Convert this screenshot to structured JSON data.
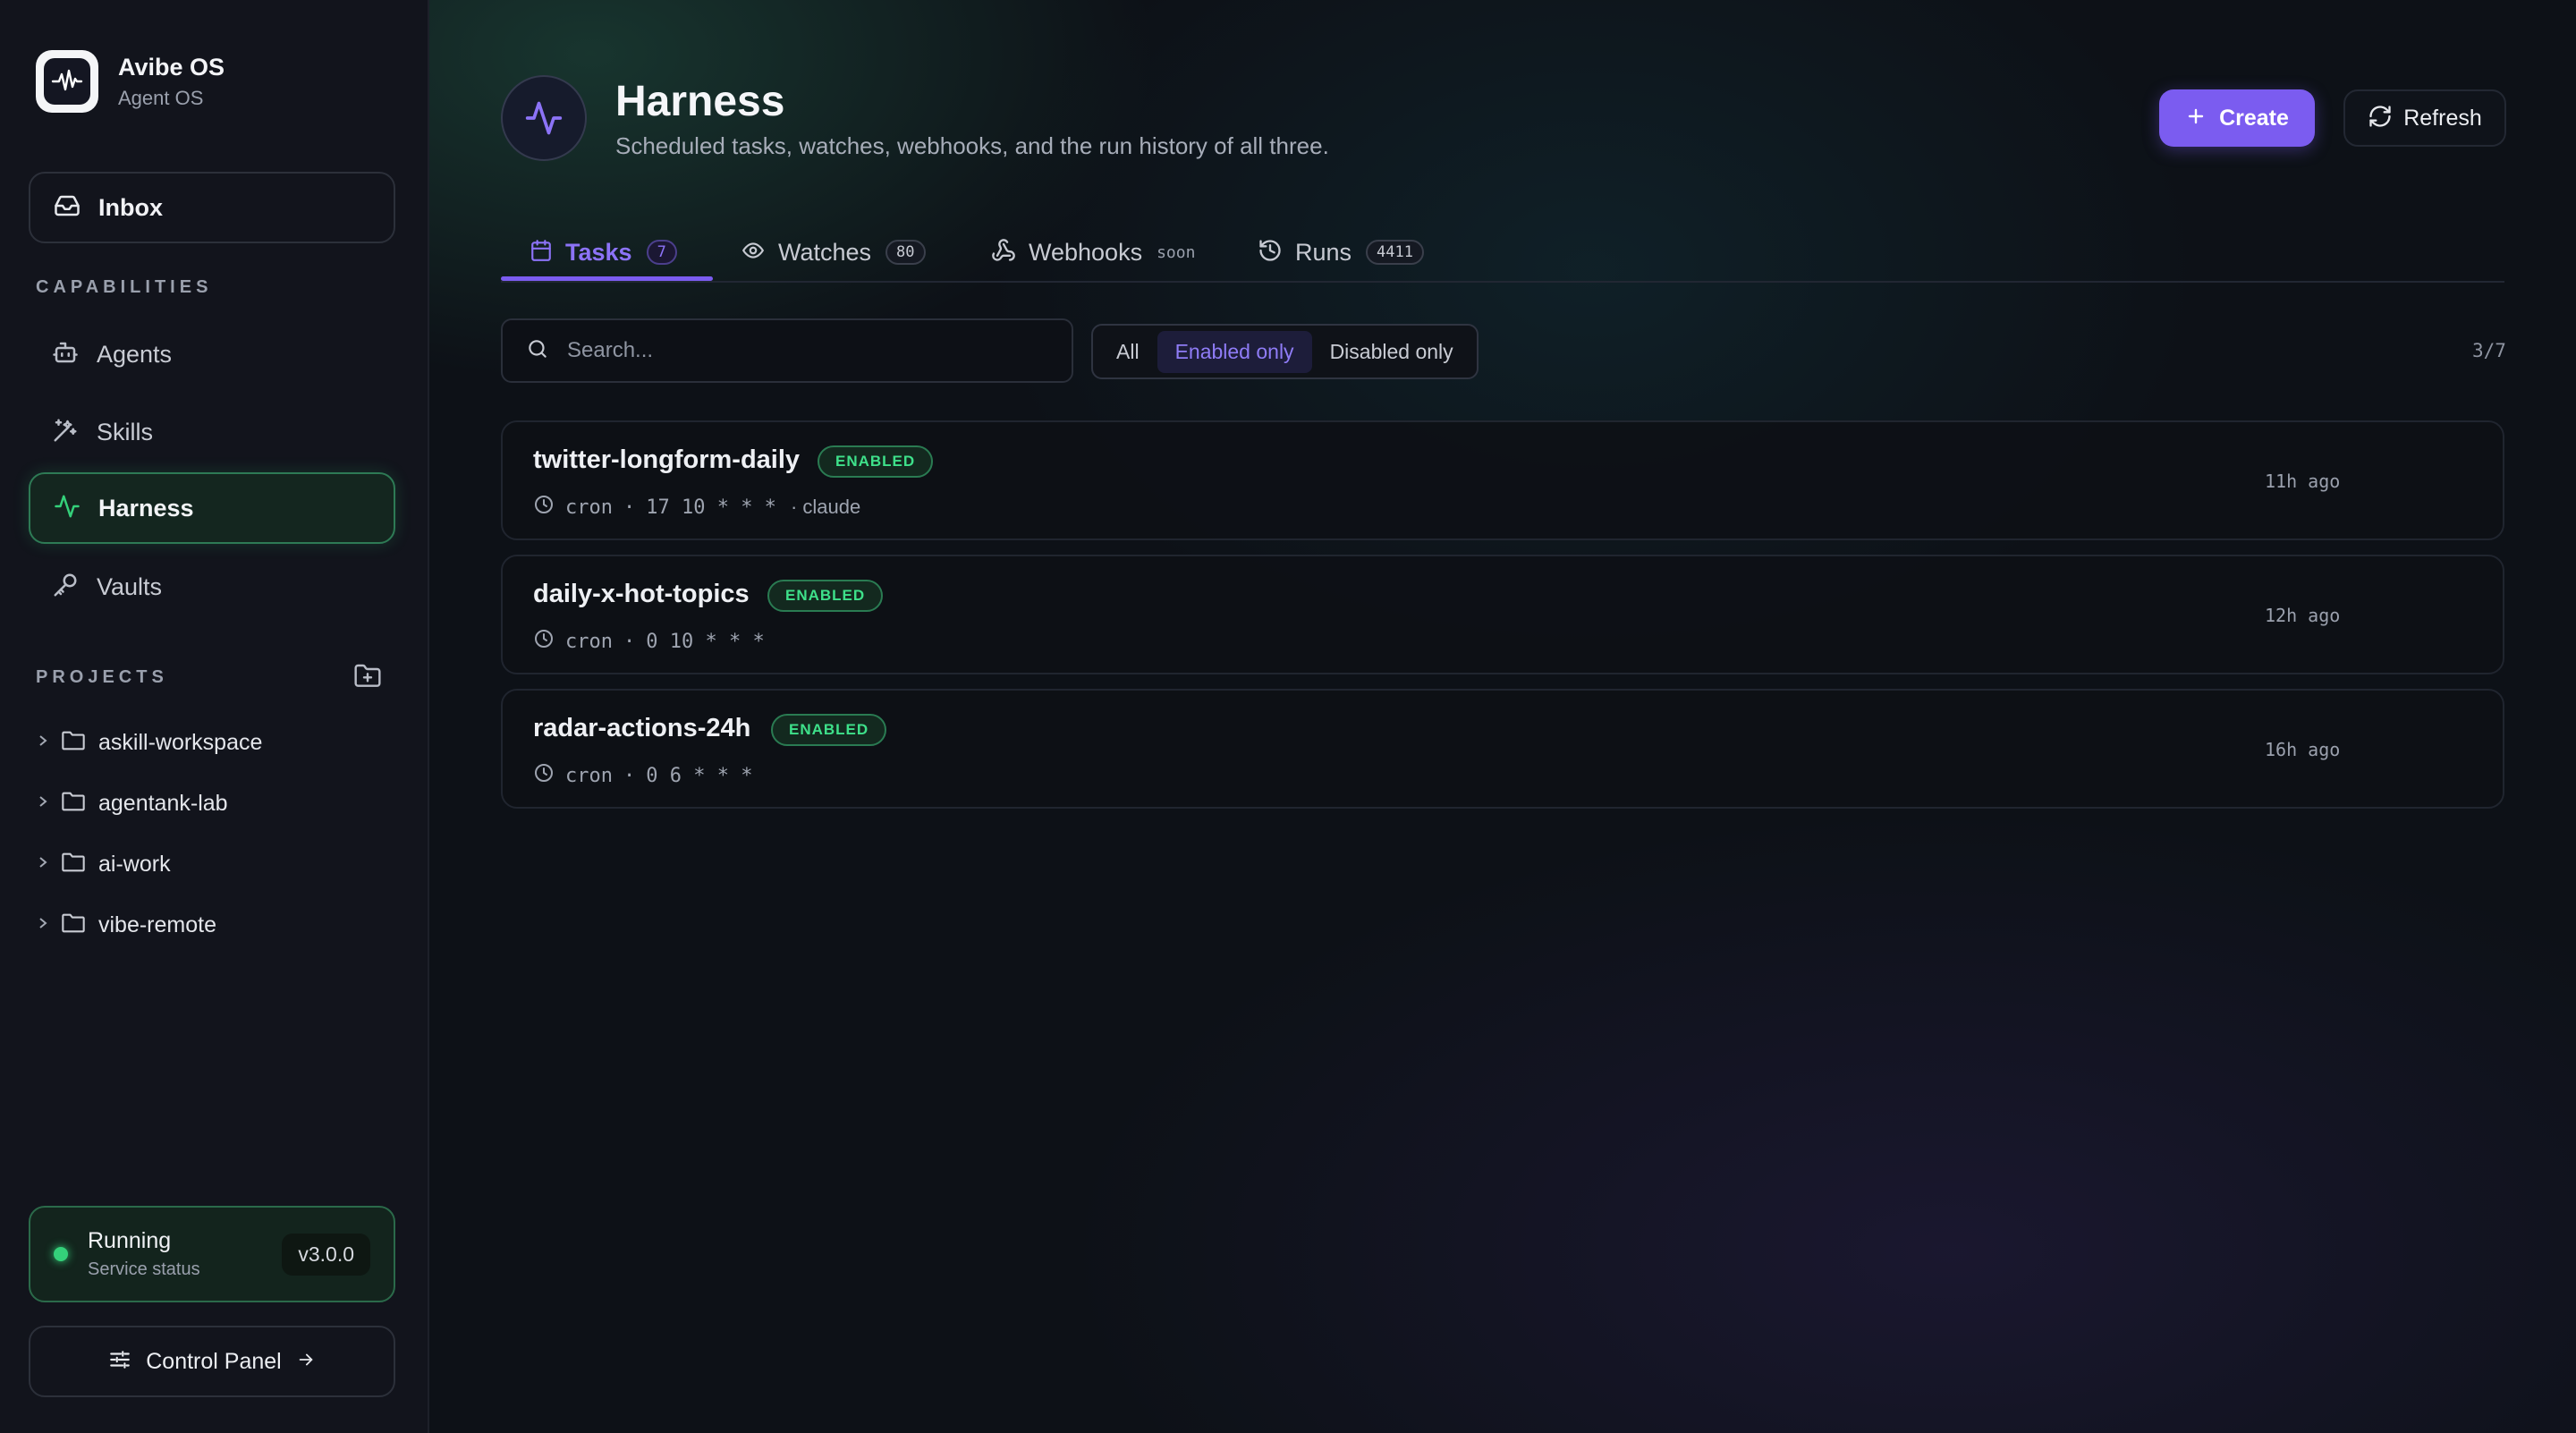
{
  "brand": {
    "name": "Avibe OS",
    "subtitle": "Agent OS"
  },
  "sidebar": {
    "inbox_label": "Inbox",
    "capabilities_title": "CAPABILITIES",
    "nav": [
      {
        "label": "Agents",
        "icon": "bot-icon"
      },
      {
        "label": "Skills",
        "icon": "magic-wand-icon"
      },
      {
        "label": "Harness",
        "icon": "activity-icon",
        "active": true
      },
      {
        "label": "Vaults",
        "icon": "key-icon"
      }
    ],
    "projects_title": "PROJECTS",
    "projects": [
      {
        "label": "askill-workspace"
      },
      {
        "label": "agentank-lab"
      },
      {
        "label": "ai-work"
      },
      {
        "label": "vibe-remote"
      }
    ],
    "status": {
      "title": "Running",
      "subtitle": "Service status",
      "version": "v3.0.0",
      "color": "#34d17a"
    },
    "control_panel_label": "Control Panel"
  },
  "header": {
    "title": "Harness",
    "subtitle": "Scheduled tasks, watches, webhooks, and the run history of all three.",
    "create_label": "Create",
    "refresh_label": "Refresh"
  },
  "tabs": [
    {
      "label": "Tasks",
      "count": "7",
      "active": true,
      "icon": "calendar-icon"
    },
    {
      "label": "Watches",
      "count": "80",
      "icon": "eye-icon"
    },
    {
      "label": "Webhooks",
      "note": "soon",
      "icon": "webhook-icon"
    },
    {
      "label": "Runs",
      "count": "4411",
      "icon": "history-icon"
    }
  ],
  "search": {
    "placeholder": "Search..."
  },
  "filters": {
    "options": [
      "All",
      "Enabled only",
      "Disabled only"
    ],
    "selected": "Enabled only"
  },
  "counter": "3/7",
  "tasks": [
    {
      "name": "twitter-longform-daily",
      "status": "ENABLED",
      "kind": "cron",
      "schedule": "17 10 * * *",
      "owner": "· claude",
      "time": "11h ago"
    },
    {
      "name": "daily-x-hot-topics",
      "status": "ENABLED",
      "kind": "cron",
      "schedule": "0 10 * * *",
      "time": "12h ago"
    },
    {
      "name": "radar-actions-24h",
      "status": "ENABLED",
      "kind": "cron",
      "schedule": "0 6 * * *",
      "time": "16h ago"
    }
  ],
  "colors": {
    "accent": "#7b5cf0",
    "success": "#34d17a"
  }
}
